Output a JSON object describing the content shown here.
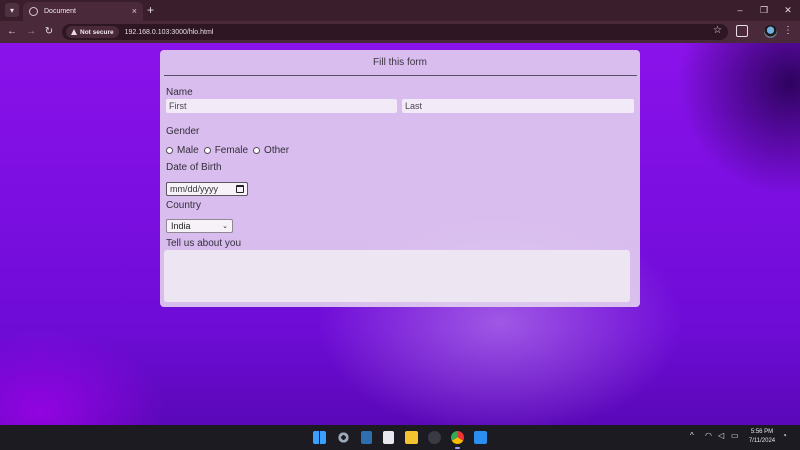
{
  "browser": {
    "tab": {
      "title": "Document"
    },
    "security_label": "Not secure",
    "url": "192.168.0.103:3000/hlo.html"
  },
  "form": {
    "heading": "Fill this form",
    "name_label": "Name",
    "first_placeholder": "First",
    "last_placeholder": "Last",
    "gender_label": "Gender",
    "gender_options": [
      "Male",
      "Female",
      "Other"
    ],
    "dob_label": "Date of Birth",
    "dob_placeholder": "mm/dd/yyyy",
    "country_label": "Country",
    "country_selected": "India",
    "about_label": "Tell us about you"
  },
  "taskbar": {
    "time": "5:56 PM",
    "date": "7/11/2024",
    "pinned_icons": [
      "windows-start-icon",
      "settings-icon",
      "calculator-icon",
      "notepad-icon",
      "file-explorer-icon",
      "app-icon",
      "chrome-icon",
      "vscode-icon"
    ]
  },
  "colors": {
    "page_background": "#7a0ee0",
    "card_background": "#e8daf0",
    "chrome_background": "#4a2a3a"
  }
}
